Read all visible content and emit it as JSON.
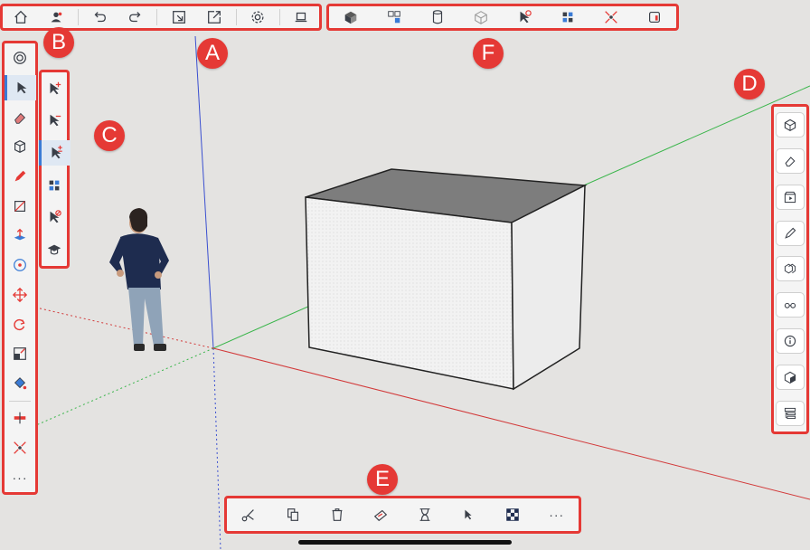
{
  "callouts": {
    "a": "A",
    "b": "B",
    "c": "C",
    "d": "D",
    "e": "E",
    "f": "F"
  },
  "toolbar_a": {
    "items": [
      "home-icon",
      "account-icon",
      "undo-icon",
      "redo-icon",
      "import-icon",
      "export-icon",
      "settings-icon",
      "display-icon"
    ]
  },
  "toolbar_f": {
    "items": [
      "solid-style-icon",
      "components-icon",
      "cylinder-icon",
      "xray-icon",
      "select-none-icon",
      "select-all-icon",
      "zoom-extents-icon",
      "style-toggle-icon"
    ]
  },
  "toolbar_b": {
    "items": [
      "model-info-icon",
      "select-tool-icon",
      "eraser-icon",
      "box-icon",
      "pencil-icon",
      "rectangle-icon",
      "push-pull-icon",
      "tape-measure-icon",
      "move-icon",
      "rotate-icon",
      "scale-icon",
      "paint-bucket-icon",
      "section-plane-icon",
      "zoom-extents-icon",
      "more-icon"
    ],
    "more_label": "···"
  },
  "toolbar_c": {
    "items": [
      "select-add-icon",
      "select-subtract-icon",
      "select-toggle-icon",
      "select-all-icon",
      "deselect-icon",
      "instructor-icon"
    ]
  },
  "toolbar_d": {
    "items": [
      "entity-info-icon",
      "tags-icon",
      "scenes-icon",
      "materials-icon",
      "components-panel-icon",
      "views-icon",
      "info-icon",
      "styles-icon",
      "outliner-icon"
    ]
  },
  "toolbar_e": {
    "items": [
      "cut-icon",
      "copy-icon",
      "delete-icon",
      "paint-icon",
      "hide-icon",
      "select-icon",
      "checker-icon",
      "more-icon"
    ],
    "more_label": "···"
  },
  "colors": {
    "highlight": "#e53935",
    "axis_red": "#d23a3a",
    "axis_green": "#39b54a",
    "axis_blue": "#3a4fd0",
    "background": "#e4e3e1"
  }
}
